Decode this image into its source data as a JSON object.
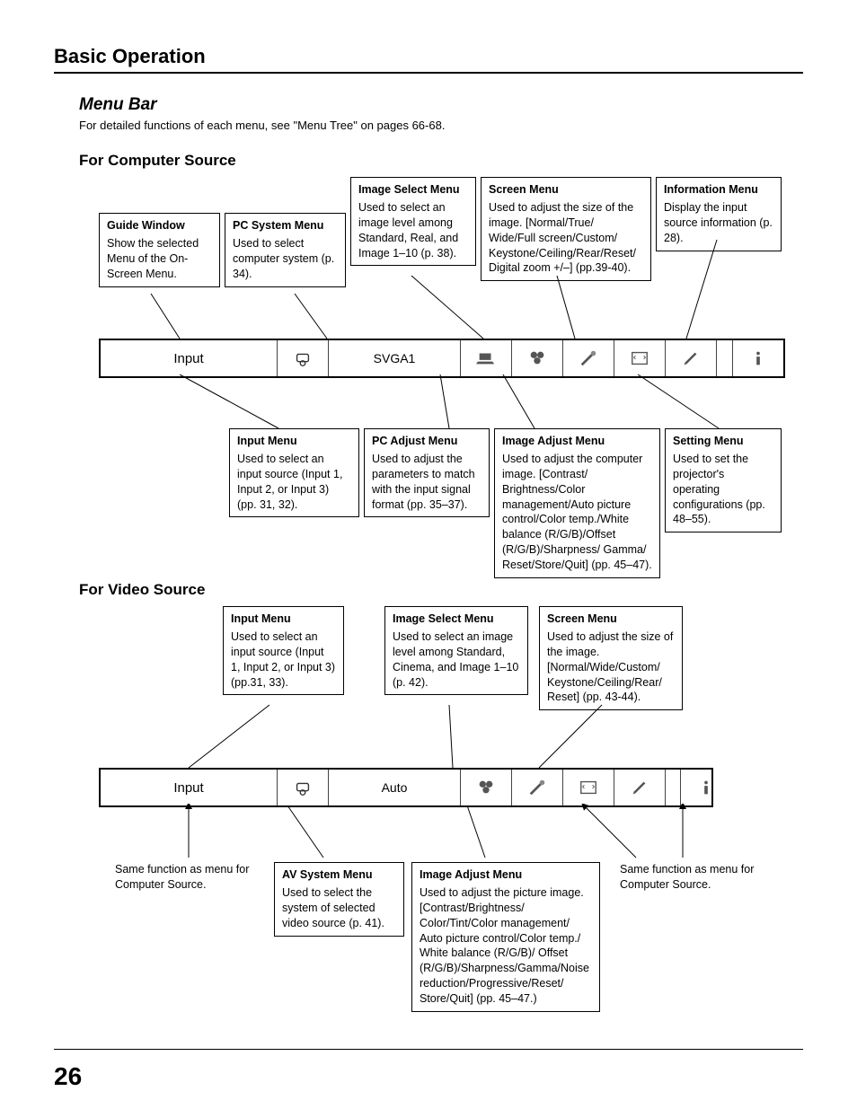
{
  "page": {
    "number": "26",
    "section": "Basic Operation",
    "heading": "Menu Bar",
    "intro": "For detailed functions of each menu, see \"Menu Tree\" on pages 66-68."
  },
  "computer": {
    "title": "For Computer Source",
    "bar": {
      "input_label": "Input",
      "mode_label": "SVGA1"
    },
    "top": {
      "guide": {
        "t": "Guide Window",
        "d": "Show the selected Menu of the On-Screen Menu."
      },
      "pcsys": {
        "t": "PC System Menu",
        "d": "Used to select computer system (p. 34)."
      },
      "imgsel": {
        "t": "Image Select Menu",
        "d": "Used to select an image level among Standard, Real, and Image 1–10 (p. 38)."
      },
      "screen": {
        "t": "Screen Menu",
        "d": "Used to adjust the size of the image. [Normal/True/ Wide/Full screen/Custom/ Keystone/Ceiling/Rear/Reset/ Digital zoom +/–] (pp.39-40)."
      },
      "info": {
        "t": "Information Menu",
        "d": "Display the input source information (p. 28)."
      }
    },
    "bottom": {
      "input": {
        "t": "Input Menu",
        "d": "Used to select an input source (Input 1, Input 2, or Input 3) (pp. 31, 32)."
      },
      "pcadj": {
        "t": "PC Adjust Menu",
        "d": "Used to adjust the parameters to match with the input signal format (pp. 35–37)."
      },
      "imgadj": {
        "t": "Image Adjust Menu",
        "d": "Used to adjust the computer image. [Contrast/ Brightness/Color management/Auto picture control/Color temp./White balance (R/G/B)/Offset (R/G/B)/Sharpness/ Gamma/ Reset/Store/Quit] (pp. 45–47)."
      },
      "setting": {
        "t": "Setting Menu",
        "d": "Used to set the projector's operating configurations (pp. 48–55)."
      }
    }
  },
  "video": {
    "title": "For Video Source",
    "bar": {
      "input_label": "Input",
      "mode_label": "Auto"
    },
    "top": {
      "input": {
        "t": "Input Menu",
        "d": "Used to select an input source (Input 1, Input 2, or Input 3) (pp.31, 33)."
      },
      "imgsel": {
        "t": "Image Select Menu",
        "d": "Used to select an image level among Standard, Cinema, and Image 1–10 (p. 42)."
      },
      "screen": {
        "t": "Screen Menu",
        "d": "Used to adjust the size of the image. [Normal/Wide/Custom/ Keystone/Ceiling/Rear/ Reset] (pp. 43-44)."
      }
    },
    "bottom": {
      "left_note": "Same function as menu for Computer Source.",
      "avsys": {
        "t": "AV System Menu",
        "d": "Used to select the system of selected video source (p. 41)."
      },
      "imgadj": {
        "t": "Image Adjust Menu",
        "d": "Used to adjust the picture image. [Contrast/Brightness/ Color/Tint/Color management/ Auto picture control/Color temp./ White balance (R/G/B)/ Offset (R/G/B)/Sharpness/Gamma/Noise reduction/Progressive/Reset/ Store/Quit] (pp. 45–47.)"
      },
      "right_note": "Same function as menu for Computer Source."
    }
  }
}
